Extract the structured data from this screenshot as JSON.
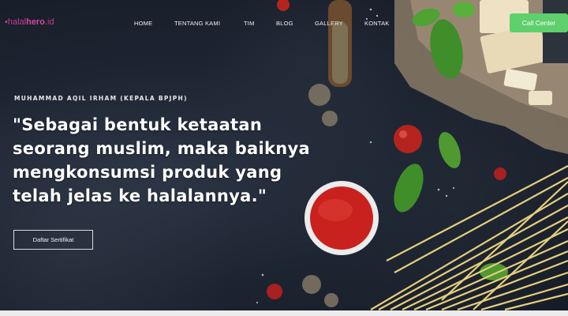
{
  "brand": {
    "logo_prefix": "•halal",
    "logo_bold": "hero",
    "logo_suffix": ".id"
  },
  "nav": {
    "items": [
      {
        "label": "HOME"
      },
      {
        "label": "TENTANG KAMI"
      },
      {
        "label": "TIM"
      },
      {
        "label": "BLOG"
      },
      {
        "label": "GALLERY"
      },
      {
        "label": "KONTAK"
      }
    ],
    "cta_label": "Call Center"
  },
  "hero": {
    "subtitle": "MUHAMMAD AQIL IRHAM (KEPALA BPJPH)",
    "quote_lines": [
      "\"Sebagai bentuk ketaatan",
      "seorang muslim, maka baiknya",
      "mengkonsumsi produk yang",
      "telah jelas ke halalannya.\""
    ],
    "button_label": "Daftar Sertifikat"
  },
  "colors": {
    "accent_green": "#5ed06c",
    "brand_pink": "#c23e91",
    "background_dark": "#1c2330"
  }
}
